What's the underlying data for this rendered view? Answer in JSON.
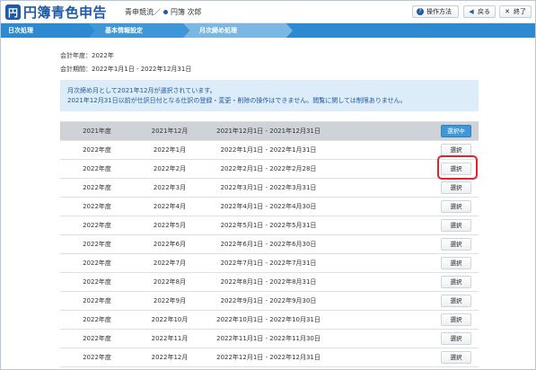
{
  "header": {
    "logo_mark": "円",
    "app_name": "円簿青色申告",
    "company": "青申競流",
    "separator": "／",
    "user": "円簿 次郎",
    "buttons": {
      "help": "操作方法",
      "back": "戻る",
      "close": "終了"
    },
    "icons": {
      "help": "?",
      "back": "◀",
      "close": "✕"
    }
  },
  "nav": {
    "steps": [
      "日次処理",
      "基本情報設定",
      "月次締め処理"
    ]
  },
  "info": {
    "fiscal_year": "会計年度：2022年",
    "period": "会計期間：2022年1月1日 - 2022年12月31日"
  },
  "notice": {
    "line1": "月次締め月として2021年12月が選択されています。",
    "line2": "2021年12月31日以前が仕訳日付となる仕訳の登録・変更・削除の操作はできません。閲覧に関しては制限ありません。"
  },
  "table": {
    "rows": [
      {
        "year": "2021年度",
        "month": "2021年12月",
        "range": "2021年12月1日 - 2021年12月31日",
        "action": "選択中"
      },
      {
        "year": "2022年度",
        "month": "2022年1月",
        "range": "2022年1月1日 - 2022年1月31日",
        "action": "選択"
      },
      {
        "year": "2022年度",
        "month": "2022年2月",
        "range": "2022年2月1日 - 2022年2月28日",
        "action": "選択"
      },
      {
        "year": "2022年度",
        "month": "2022年3月",
        "range": "2022年3月1日 - 2022年3月31日",
        "action": "選択"
      },
      {
        "year": "2022年度",
        "month": "2022年4月",
        "range": "2022年4月1日 - 2022年4月30日",
        "action": "選択"
      },
      {
        "year": "2022年度",
        "month": "2022年5月",
        "range": "2022年5月1日 - 2022年5月31日",
        "action": "選択"
      },
      {
        "year": "2022年度",
        "month": "2022年6月",
        "range": "2022年6月1日 - 2022年6月30日",
        "action": "選択"
      },
      {
        "year": "2022年度",
        "month": "2022年7月",
        "range": "2022年7月1日 - 2022年7月31日",
        "action": "選択"
      },
      {
        "year": "2022年度",
        "month": "2022年8月",
        "range": "2022年8月1日 - 2022年8月31日",
        "action": "選択"
      },
      {
        "year": "2022年度",
        "month": "2022年9月",
        "range": "2022年9月1日 - 2022年9月30日",
        "action": "選択"
      },
      {
        "year": "2022年度",
        "month": "2022年10月",
        "range": "2022年10月1日 - 2022年10月31日",
        "action": "選択"
      },
      {
        "year": "2022年度",
        "month": "2022年11月",
        "range": "2022年11月1日 - 2022年11月30日",
        "action": "選択"
      },
      {
        "year": "2022年度",
        "month": "2022年12月",
        "range": "2022年12月1日 - 2022年12月31日",
        "action": "選択"
      }
    ]
  },
  "colors": {
    "brand": "#1f5aa8",
    "nav": "#2e8ad0",
    "notice_bg": "#dcecf8",
    "highlight": "#e0242b"
  }
}
